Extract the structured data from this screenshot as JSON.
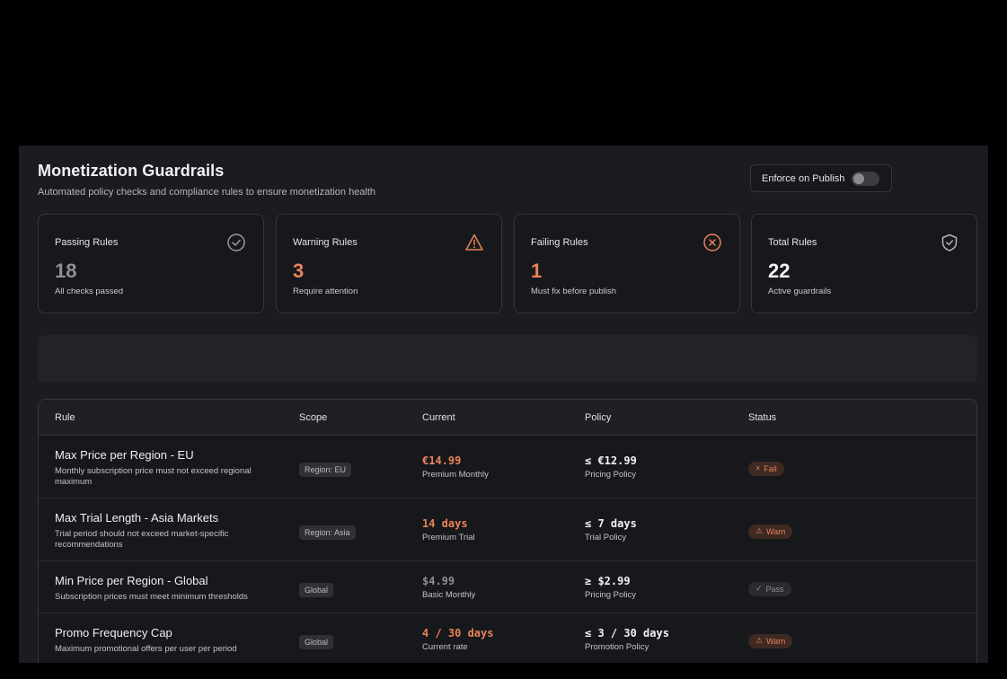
{
  "header": {
    "title": "Monetization Guardrails",
    "subtitle": "Automated policy checks and compliance rules to ensure monetization health",
    "enforce_label": "Enforce on Publish",
    "enforce_enabled": false
  },
  "cards": [
    {
      "label": "Passing Rules",
      "value": "18",
      "note": "All checks passed",
      "icon": "check-circle-icon",
      "color": "#8f9095"
    },
    {
      "label": "Warning Rules",
      "value": "3",
      "note": "Require attention",
      "icon": "warning-triangle-icon",
      "color": "#e8835a"
    },
    {
      "label": "Failing Rules",
      "value": "1",
      "note": "Must fix before publish",
      "icon": "x-circle-icon",
      "color": "#e8835a"
    },
    {
      "label": "Total Rules",
      "value": "22",
      "note": "Active guardrails",
      "icon": "shield-check-icon",
      "color": "#f2f2f4"
    }
  ],
  "table": {
    "columns": [
      "Rule",
      "Scope",
      "Current",
      "Policy",
      "Status"
    ],
    "rows": [
      {
        "name": "Max Price per Region - EU",
        "desc": "Monthly subscription price must not exceed regional maximum",
        "scope": "Region: EU",
        "current": "€14.99",
        "current_note": "Premium Monthly",
        "policy": "≤ €12.99",
        "policy_note": "Pricing Policy",
        "status": "Fail",
        "status_glyph": "×",
        "current_color": "#e8835a"
      },
      {
        "name": "Max Trial Length - Asia Markets",
        "desc": "Trial period should not exceed market-specific recommendations",
        "scope": "Region: Asia",
        "current": "14 days",
        "current_note": "Premium Trial",
        "policy": "≤ 7 days",
        "policy_note": "Trial Policy",
        "status": "Warn",
        "status_glyph": "⚠",
        "current_color": "#e8835a"
      },
      {
        "name": "Min Price per Region - Global",
        "desc": "Subscription prices must meet minimum thresholds",
        "scope": "Global",
        "current": "$4.99",
        "current_note": "Basic Monthly",
        "policy": "≥ $2.99",
        "policy_note": "Pricing Policy",
        "status": "Pass",
        "status_glyph": "✓",
        "current_color": "#8f9095"
      },
      {
        "name": "Promo Frequency Cap",
        "desc": "Maximum promotional offers per user per period",
        "scope": "Global",
        "current": "4 / 30 days",
        "current_note": "Current rate",
        "policy": "≤ 3 / 30 days",
        "policy_note": "Promotion Policy",
        "status": "Warn",
        "status_glyph": "⚠",
        "current_color": "#e8835a"
      }
    ]
  }
}
